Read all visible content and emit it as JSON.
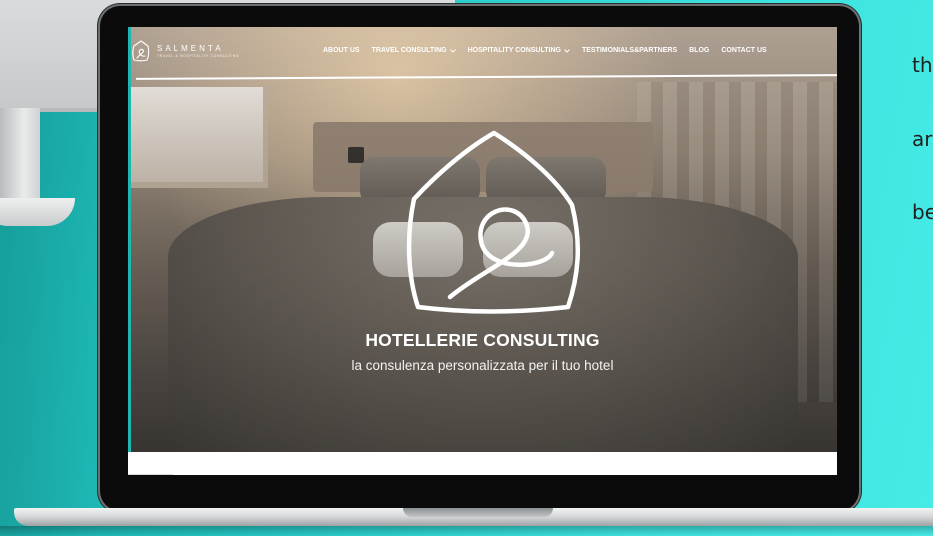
{
  "side_text": {
    "lines": [
      "th",
      "ar",
      "be"
    ]
  },
  "website": {
    "brand": {
      "name": "SALMENTA",
      "tagline": "TRAVEL & HOSPITALITY CONSULTING"
    },
    "nav": [
      {
        "label": "ABOUT US",
        "has_dropdown": false
      },
      {
        "label": "TRAVEL CONSULTING",
        "has_dropdown": true
      },
      {
        "label": "HOSPITALITY CONSULTING",
        "has_dropdown": true
      },
      {
        "label": "TESTIMONIALS&PARTNERS",
        "has_dropdown": false
      },
      {
        "label": "BLOG",
        "has_dropdown": false
      },
      {
        "label": "CONTACT US",
        "has_dropdown": false
      }
    ],
    "hero": {
      "title": "HOTELLERIE CONSULTING",
      "subtitle": "la consulenza personalizzata per il tuo hotel"
    }
  },
  "colors": {
    "background_teal": "#25c6c3",
    "laptop_bezel": "#0b0b0b",
    "nav_text": "#ffffff",
    "hero_text": "#ffffff"
  }
}
